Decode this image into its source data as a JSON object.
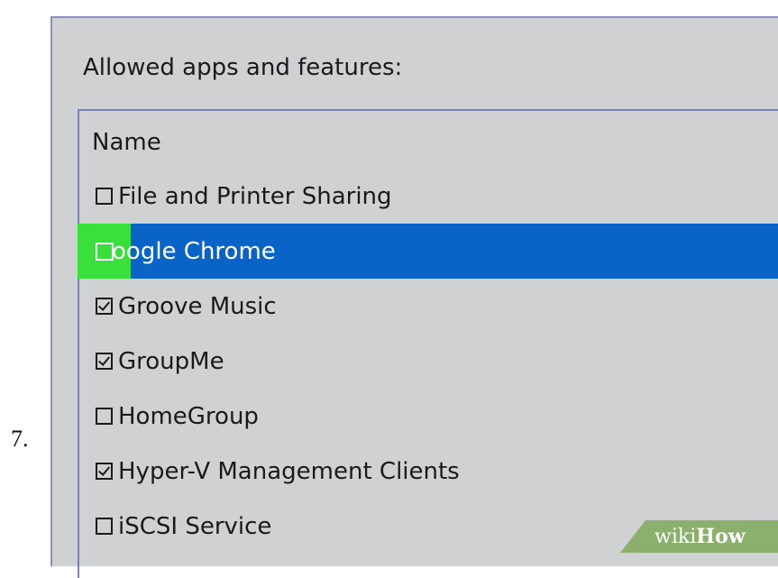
{
  "step_number": "7.",
  "panel": {
    "title": "Allowed apps and features:"
  },
  "list": {
    "header": "Name",
    "items": [
      {
        "label": "File and Printer Sharing",
        "checked": false,
        "selected": false
      },
      {
        "label": "Google Chrome",
        "checked": false,
        "selected": true
      },
      {
        "label": "Groove Music",
        "checked": true,
        "selected": false
      },
      {
        "label": "GroupMe",
        "checked": true,
        "selected": false
      },
      {
        "label": "HomeGroup",
        "checked": false,
        "selected": false
      },
      {
        "label": "Hyper-V Management Clients",
        "checked": true,
        "selected": false
      },
      {
        "label": "iSCSI Service",
        "checked": false,
        "selected": false
      }
    ],
    "visible_selected_label": "oogle Chrome"
  },
  "watermark": {
    "wiki": "wiki",
    "how": "How"
  },
  "colors": {
    "selection": "#0a64c8",
    "highlight": "#39e03c",
    "panel_bg": "#cfd1d3",
    "border": "#8b8fc0"
  }
}
